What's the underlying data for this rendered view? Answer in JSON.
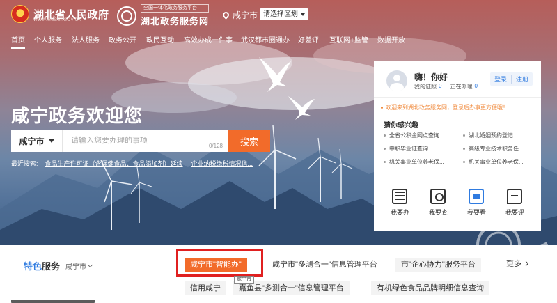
{
  "header": {
    "gov_title": "湖北省人民政府",
    "gov_sub": "WWW.HUBEI.GOV.CN",
    "portal_small": "全国一体化政务服务平台",
    "portal_big": "湖北政务服务网",
    "location": "咸宁市",
    "region_select": "请选择区划"
  },
  "nav": {
    "items": [
      "首页",
      "个人服务",
      "法人服务",
      "政务公开",
      "政民互动",
      "高效办成一件事",
      "武汉都市圈通办",
      "好差评",
      "互联网+监管",
      "数据开放"
    ]
  },
  "hero": {
    "headline": "咸宁政务欢迎您",
    "search_city": "咸宁市",
    "search_placeholder": "请输入您要办理的事项",
    "search_count": "0/128",
    "search_button": "搜索",
    "recent_label": "最近搜索:",
    "recent_links": [
      "食品生产许可证（含保健食品、食品添加剂）延续",
      "企业纳税缴税情况信..."
    ]
  },
  "panel": {
    "hello": "嗨！你好",
    "cert_label": "我的证照",
    "cert_count": "0",
    "doing_label": "正在办理",
    "doing_count": "0",
    "login": "登录",
    "register": "注册",
    "notice": "欢迎来到湖北政务服务网，登录后办事更方便哦！",
    "interest_title": "猜你感兴趣",
    "interest_items": [
      "全省公积金网点查询",
      "湖北婚姻预约登记",
      "中职毕业证查询",
      "高级专业技术职务任...",
      "机关事业单位养老保...",
      "机关事业单位养老保..."
    ],
    "quick_actions": [
      {
        "label": "我要办",
        "icon": "building-icon"
      },
      {
        "label": "我要查",
        "icon": "document-search-icon"
      },
      {
        "label": "我要看",
        "icon": "mobile-screen-icon"
      },
      {
        "label": "我要评",
        "icon": "comment-icon"
      }
    ]
  },
  "services": {
    "title_a": "特色",
    "title_b": "服务",
    "city": "咸宁市",
    "row1": [
      "咸宁市\"智能办\"",
      "咸宁市\"多测合一\"信息管理平台",
      "市\"企心协力\"服务平台"
    ],
    "more": "更多",
    "row2": [
      "信用咸宁",
      "嘉鱼县\"多测合一\"信息管理平台",
      "有机绿色食品品牌明细信息查询"
    ],
    "tooltip": "咸宁市"
  },
  "colors": {
    "accent": "#f26b2a",
    "link_blue": "#2f7be0",
    "highlight_red": "#e02020"
  }
}
